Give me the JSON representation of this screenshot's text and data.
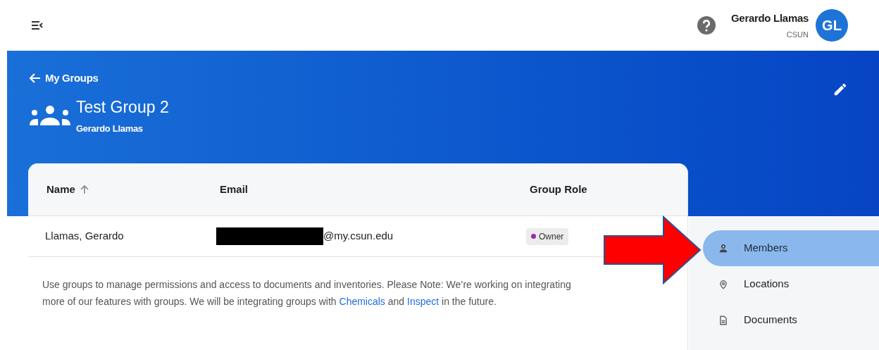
{
  "header": {
    "user_name": "Gerardo Llamas",
    "organization": "CSUN",
    "avatar_initials": "GL"
  },
  "banner": {
    "back_link": "My Groups",
    "title": "Test Group 2",
    "subtitle": "Gerardo Llamas"
  },
  "table": {
    "columns": [
      {
        "label": "Name",
        "sorted": true
      },
      {
        "label": "Email",
        "sorted": false
      },
      {
        "label": "Group Role",
        "sorted": false
      }
    ],
    "rows": [
      {
        "name": "Llamas, Gerardo",
        "email": "@my.csun.edu",
        "email_redacted": true,
        "role": "Owner",
        "color": "#9c27b0"
      }
    ]
  },
  "note": {
    "parts": [
      {
        "kind": "text",
        "text": "Use groups to manage permissions and access to documents and inventories. Please Note: We’re working on integrating more of our features with groups. We will be integrating groups with "
      },
      {
        "kind": "link",
        "text": "Chemicals"
      },
      {
        "kind": "text",
        "text": " and "
      },
      {
        "kind": "link",
        "text": "Inspect"
      },
      {
        "kind": "text",
        "text": " in the future."
      }
    ]
  },
  "sidebar": {
    "items": [
      {
        "label": "Members",
        "kind": "person",
        "selected": true
      },
      {
        "label": "Locations",
        "kind": "pin",
        "selected": false
      },
      {
        "label": "Documents",
        "kind": "doc",
        "selected": false
      }
    ]
  },
  "annotation": {
    "kind": "arrow"
  }
}
